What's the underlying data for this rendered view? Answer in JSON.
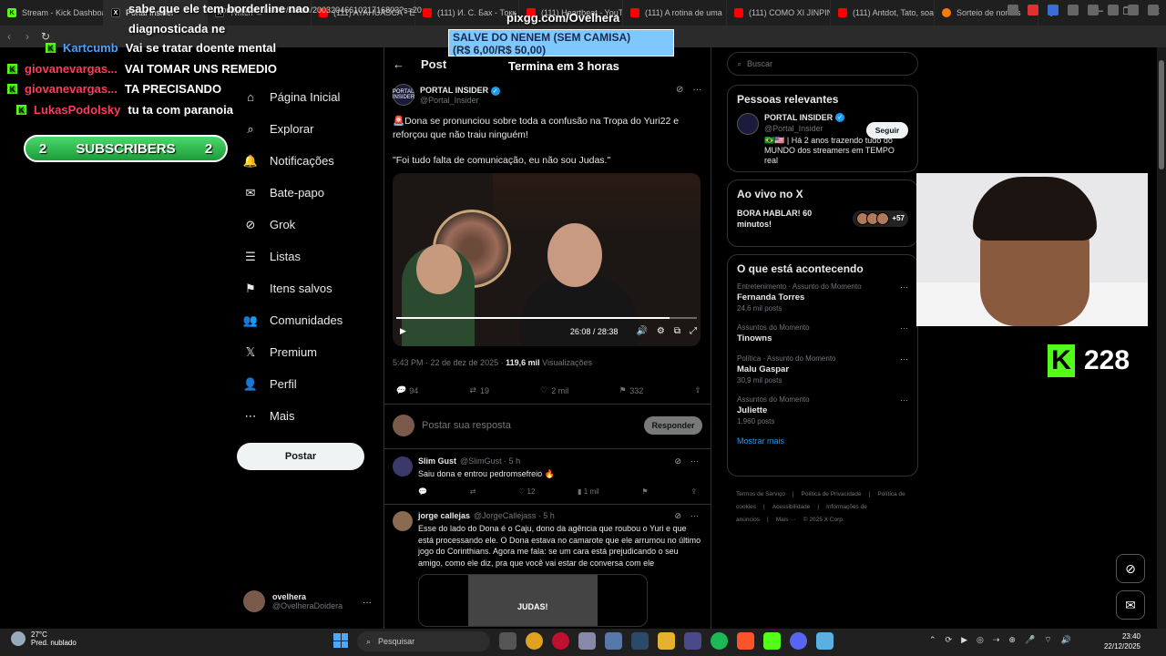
{
  "browser": {
    "tabs": [
      {
        "label": "Stream - Kick Dashboa",
        "favicon": "kick"
      },
      {
        "label": "Portal Insider",
        "favicon": "x",
        "active": true
      },
      {
        "label": "Twitch",
        "favicon": "x"
      },
      {
        "label": "(111) AYAHUASCA - En",
        "favicon": "yt"
      },
      {
        "label": "(111) И. С. Бах - Токк",
        "favicon": "yt"
      },
      {
        "label": "(111) Heartbeat - YouT",
        "favicon": "yt"
      },
      {
        "label": "(111) A rotina de uma",
        "favicon": "yt"
      },
      {
        "label": "(111) COMO XI JINPIN",
        "favicon": "yt"
      },
      {
        "label": "(111) Antdot, Tato, soa",
        "favicon": "yt"
      },
      {
        "label": "Sorteio de nomes",
        "favicon": "sorteio"
      }
    ],
    "new_tab": "+",
    "url": "x.com/Portal_Insider/status/2003204661021716803?s=20"
  },
  "overlay": {
    "chat": [
      {
        "user": "",
        "msg": "sabe que ele tem borderline nao",
        "color": "white"
      },
      {
        "user": "",
        "msg": "diagnosticada ne",
        "color": "white"
      },
      {
        "user": "Kartcumb",
        "msg": "Vai se tratar doente mental",
        "color": "blue"
      },
      {
        "user": "giovanevargas...",
        "msg": "VAI TOMAR UNS REMEDIO",
        "color": "red"
      },
      {
        "user": "giovanevargas...",
        "msg": "TA PRECISANDO",
        "color": "red"
      },
      {
        "user": "LukasPodolsky",
        "msg": "tu ta com paranoia",
        "color": "red"
      }
    ],
    "subs_label": "SUBSCRIBERS",
    "subs_left": "2",
    "subs_right": "2",
    "pix": "pixgg.com/Ovelhera",
    "salve_line1": "SALVE DO NENEM (SEM CAMISA)",
    "salve_line2": "(R$ 6,00/R$ 50,00)",
    "timer": "Termina em 3 horas",
    "kick_count": "228"
  },
  "nav": {
    "items": [
      {
        "label": "Página Inicial",
        "icon": "home-icon",
        "glyph": "⌂"
      },
      {
        "label": "Explorar",
        "icon": "search-icon",
        "glyph": "⌕"
      },
      {
        "label": "Notificações",
        "icon": "bell-icon",
        "glyph": "🔔"
      },
      {
        "label": "Bate-papo",
        "icon": "mail-icon",
        "glyph": "✉"
      },
      {
        "label": "Grok",
        "icon": "grok-icon",
        "glyph": "⊘"
      },
      {
        "label": "Listas",
        "icon": "list-icon",
        "glyph": "☰"
      },
      {
        "label": "Itens salvos",
        "icon": "bookmark-icon",
        "glyph": "⚑"
      },
      {
        "label": "Comunidades",
        "icon": "communities-icon",
        "glyph": "👥"
      },
      {
        "label": "Premium",
        "icon": "x-logo-icon",
        "glyph": "𝕏"
      },
      {
        "label": "Perfil",
        "icon": "profile-icon",
        "glyph": "👤"
      },
      {
        "label": "Mais",
        "icon": "more-icon",
        "glyph": "⋯"
      }
    ],
    "post_button": "Postar",
    "account_name": "ovelhera",
    "account_handle": "@OvelheraDoidera"
  },
  "post": {
    "header": "Post",
    "author_name": "PORTAL INSIDER",
    "author_handle": "@Portal_Insider",
    "avatar_text": "PORTAL INSIDER",
    "text_1": "🚨Dona se pronunciou sobre toda a confusão na Tropa do Yuri22 e reforçou que não traiu ninguém!",
    "text_2": "\"Foi tudo falta de comunicação, eu não sou Judas.\"",
    "video_time": "26:08 / 28:38",
    "video_progress": 0.91,
    "timestamp": "5:43 PM · 22 de dez de 2025 · ",
    "views": "119,6 mil",
    "views_label": " Visualizações",
    "replies": "94",
    "reposts": "19",
    "likes": "2 mil",
    "bookmarks": "332",
    "reply_placeholder": "Postar sua resposta",
    "reply_button": "Responder"
  },
  "replies": [
    {
      "name": "Slim Gust",
      "handle": "@SlimGust · 5 h",
      "text": "Saiu dona e entrou pedromsefreio 🔥",
      "likes": "12",
      "views": "1 mil"
    },
    {
      "name": "jorge callejas",
      "handle": "@JorgeCallejass · 5 h",
      "text": "Esse do lado do Dona é o Caju, dono da agência que roubou o Yuri e que está processando ele. O Dona estava no camarote que ele arrumou no último jogo do Corinthians. Agora me fala: se um cara está prejudicando o seu amigo, como ele diz, pra que você vai estar de conversa com ele",
      "image_text": "JUDAS!"
    }
  ],
  "sidebar": {
    "search_placeholder": "Buscar",
    "relevant_title": "Pessoas relevantes",
    "rel_name": "PORTAL INSIDER",
    "rel_handle": "@Portal_Insider",
    "rel_bio": "🇧🇷🇺🇸 | Há 2 anos trazendo tudo do MUNDO dos streamers em TEMPO real",
    "follow": "Seguir",
    "live_title": "Ao vivo no X",
    "live_text": "BORA HABLAR! 60 minutos!",
    "live_count": "+57",
    "trends_title": "O que está acontecendo",
    "trends": [
      {
        "cat": "Entretenimento · Assunto do Momento",
        "name": "Fernanda Torres",
        "count": "24,6 mil posts"
      },
      {
        "cat": "Assuntos do Momento",
        "name": "Tinowns",
        "count": ""
      },
      {
        "cat": "Política · Assunto do Momento",
        "name": "Malu Gaspar",
        "count": "30,9 mil posts"
      },
      {
        "cat": "Assuntos do Momento",
        "name": "Juliette",
        "count": "1.960 posts"
      }
    ],
    "show_more": "Mostrar mais",
    "footer": [
      "Termos de Serviço",
      "|",
      "Política de Privacidade",
      "|",
      "Política de cookies",
      "|",
      "Acessibilidade",
      "|",
      "Informações de anúncios",
      "|",
      "Mais ···",
      "© 2025 X Corp."
    ]
  },
  "taskbar": {
    "temp": "27°C",
    "weather": "Pred. nublado",
    "weather_badge": "3",
    "search": "Pesquisar",
    "time": "23:40",
    "date": "22/12/2025"
  }
}
